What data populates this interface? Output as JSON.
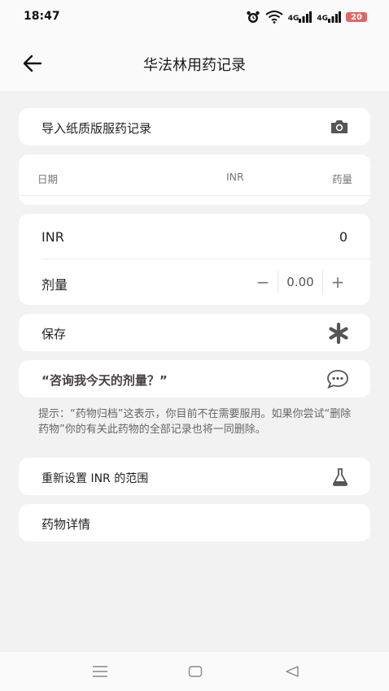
{
  "status": {
    "time": "18:47",
    "signal1": "4G",
    "signal2": "4G",
    "battery": "20"
  },
  "header": {
    "title": "华法林用药记录"
  },
  "import_row": {
    "label": "导入纸质版服药记录"
  },
  "table": {
    "col_date": "日期",
    "col_inr": "INR",
    "col_dose": "药量"
  },
  "inr_row": {
    "label": "INR",
    "value": "0"
  },
  "dose_row": {
    "label": "剂量",
    "minus": "−",
    "value": "0.00",
    "plus": "+"
  },
  "save_row": {
    "label": "保存"
  },
  "ask_row": {
    "label": "“咨询我今天的剂量？”"
  },
  "hint": "提示：“药物归档”这表示，你目前不在需要服用。如果你尝试“删除药物”你的有关此药物的全部记录也将一同删除。",
  "reset_row": {
    "label": "重新设置 INR 的范围"
  },
  "detail_row": {
    "label": "药物详情"
  }
}
